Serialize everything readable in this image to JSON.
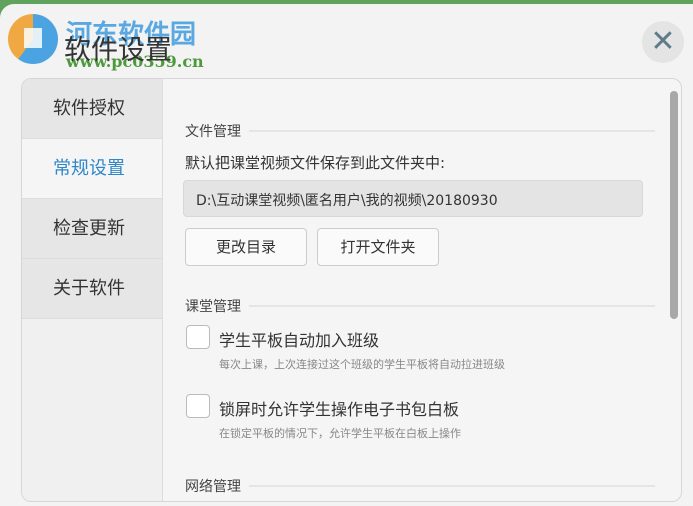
{
  "watermark": {
    "name": "河东软件园",
    "url": "www.pc0359.cn"
  },
  "window": {
    "title": "软件设置",
    "close_icon": "close-icon"
  },
  "sidebar": {
    "items": [
      {
        "label": "软件授权"
      },
      {
        "label": "常规设置",
        "active": true
      },
      {
        "label": "检查更新"
      },
      {
        "label": "关于软件"
      }
    ]
  },
  "file": {
    "header": "文件管理",
    "label": "默认把课堂视频文件保存到此文件夹中:",
    "path": "D:\\互动课堂视频\\匿名用户\\我的视频\\20180930",
    "change_dir": "更改目录",
    "open_folder": "打开文件夹"
  },
  "classroom": {
    "header": "课堂管理",
    "options": [
      {
        "label": "学生平板自动加入班级",
        "hint": "每次上课，上次连接过这个班级的学生平板将自动拉进班级",
        "checked": false
      },
      {
        "label": "锁屏时允许学生操作电子书包白板",
        "hint": "在锁定平板的情况下，允许学生平板在白板上操作",
        "checked": false
      }
    ]
  },
  "network": {
    "header": "网络管理"
  }
}
